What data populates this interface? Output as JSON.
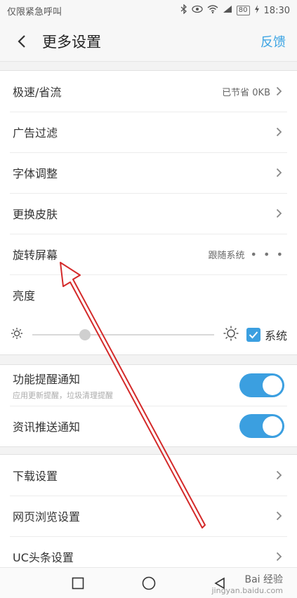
{
  "status": {
    "carrier": "仅限紧急呼叫",
    "battery": "80",
    "time": "18:30"
  },
  "header": {
    "title": "更多设置",
    "feedback": "反馈"
  },
  "section1": {
    "items": [
      {
        "label": "极速/省流",
        "value": "已节省 0KB"
      },
      {
        "label": "广告过滤"
      },
      {
        "label": "字体调整"
      },
      {
        "label": "更换皮肤"
      },
      {
        "label": "旋转屏幕",
        "value": "跟随系统"
      }
    ],
    "brightness": {
      "label": "亮度",
      "level": 0.29,
      "system_label": "系统",
      "system_checked": true
    }
  },
  "section2": {
    "items": [
      {
        "label": "功能提醒通知",
        "sub": "应用更新提醒，垃圾清理提醒",
        "on": true
      },
      {
        "label": "资讯推送通知",
        "on": true
      }
    ]
  },
  "section3": {
    "items": [
      {
        "label": "下载设置"
      },
      {
        "label": "网页浏览设置"
      },
      {
        "label": "UC头条设置"
      }
    ]
  },
  "watermark": {
    "brand": "Bai 经验",
    "url": "jingyan.baidu.com"
  },
  "colors": {
    "accent": "#3b9fe0",
    "annotation_arrow": "#d42a2a"
  }
}
